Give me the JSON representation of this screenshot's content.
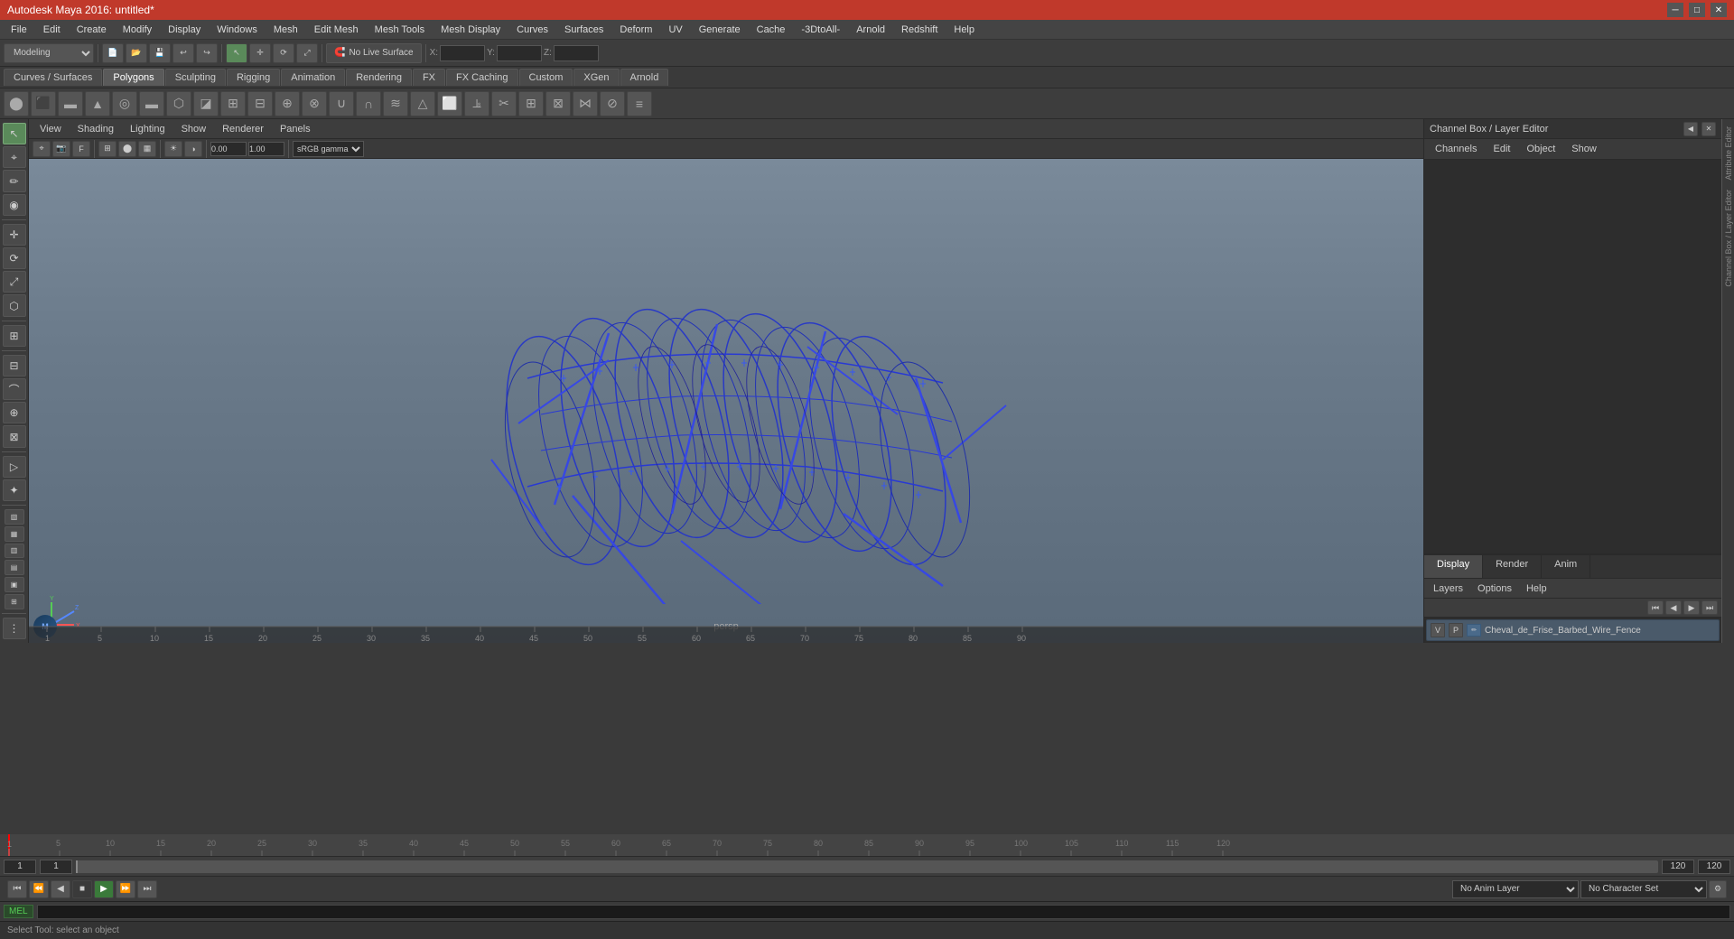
{
  "titlebar": {
    "title": "Autodesk Maya 2016: untitled*",
    "minimize": "─",
    "maximize": "□",
    "close": "✕"
  },
  "menubar": {
    "items": [
      "File",
      "Edit",
      "Create",
      "Modify",
      "Display",
      "Windows",
      "Mesh",
      "Edit Mesh",
      "Mesh Tools",
      "Mesh Display",
      "Curves",
      "Surfaces",
      "Deform",
      "UV",
      "Generate",
      "Cache",
      "-3DtoAll-",
      "Arnold",
      "Redshift",
      "Help"
    ]
  },
  "toolbar1": {
    "modeling_label": "Modeling",
    "live_surface": "No Live Surface",
    "x_label": "X:",
    "y_label": "Y:",
    "z_label": "Z:"
  },
  "shelf_tabs": {
    "items": [
      "Curves / Surfaces",
      "Polygons",
      "Sculpting",
      "Rigging",
      "Animation",
      "Rendering",
      "FX",
      "FX Caching",
      "Custom",
      "XGen",
      "Arnold"
    ],
    "active": "Polygons"
  },
  "viewport_menu": {
    "items": [
      "View",
      "Shading",
      "Lighting",
      "Show",
      "Renderer",
      "Panels"
    ]
  },
  "viewport": {
    "camera": "persp",
    "gamma": "sRGB gamma"
  },
  "right_panel": {
    "title": "Channel Box / Layer Editor",
    "channel_menu": [
      "Channels",
      "Edit",
      "Object",
      "Show"
    ]
  },
  "layer_editor": {
    "tabs": [
      "Display",
      "Render",
      "Anim"
    ],
    "active_tab": "Display",
    "sub_menu": [
      "Layers",
      "Options",
      "Help"
    ],
    "layer_row": {
      "v": "V",
      "p": "P",
      "name": "Cheval_de_Frise_Barbed_Wire_Fence"
    }
  },
  "timeline": {
    "ticks": [
      "1",
      "5",
      "10",
      "15",
      "20",
      "25",
      "30",
      "35",
      "40",
      "45",
      "50",
      "55",
      "60",
      "65",
      "70",
      "75",
      "80",
      "85",
      "90",
      "95",
      "100",
      "105",
      "110",
      "115",
      "120"
    ],
    "start": "1",
    "end": "120",
    "current": "1",
    "range_start": "1",
    "range_end": "120"
  },
  "transport": {
    "buttons": [
      "⏮",
      "⏪",
      "◀◀",
      "◀",
      "▶",
      "▶▶",
      "⏩",
      "⏭",
      "⟲"
    ],
    "anim_layer_label": "No Anim Layer",
    "char_set_label": "No Character Set"
  },
  "bottom": {
    "mel_label": "MEL",
    "cmd_placeholder": "",
    "status": "Select Tool: select an object"
  },
  "left_tools": [
    "↖",
    "↔",
    "↕",
    "⟳",
    "⬜",
    "◎",
    "◪",
    "▷",
    "✦",
    "⬡",
    "⬢",
    "⬣"
  ],
  "model_name": "Cheval_de_Frise_Barbed_Wire_Fence"
}
